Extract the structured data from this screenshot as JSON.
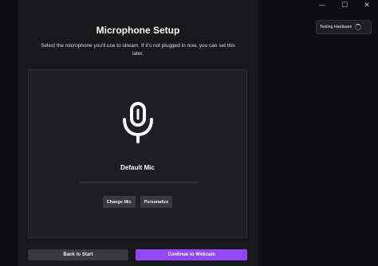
{
  "window": {
    "minimize_glyph": "—",
    "maximize_glyph": "☐",
    "close_glyph": "✕"
  },
  "setup": {
    "title": "Microphone Setup",
    "subtitle": "Select the microphone you'll use to stream. If it's not plugged in now, you can set this later.",
    "mic_icon": "microphone-icon",
    "mic_name": "Default Mic",
    "mic_level": 0.0,
    "change_mic_label": "Change Mic",
    "personalize_label": "Personalize"
  },
  "footer": {
    "back_label": "Back to Start",
    "continue_label": "Continue to Webcam"
  },
  "status": {
    "testing_label": "Testing Hardware"
  },
  "colors": {
    "accent": "#9147ff",
    "panel": "#18181b",
    "background": "#0e0e10"
  }
}
